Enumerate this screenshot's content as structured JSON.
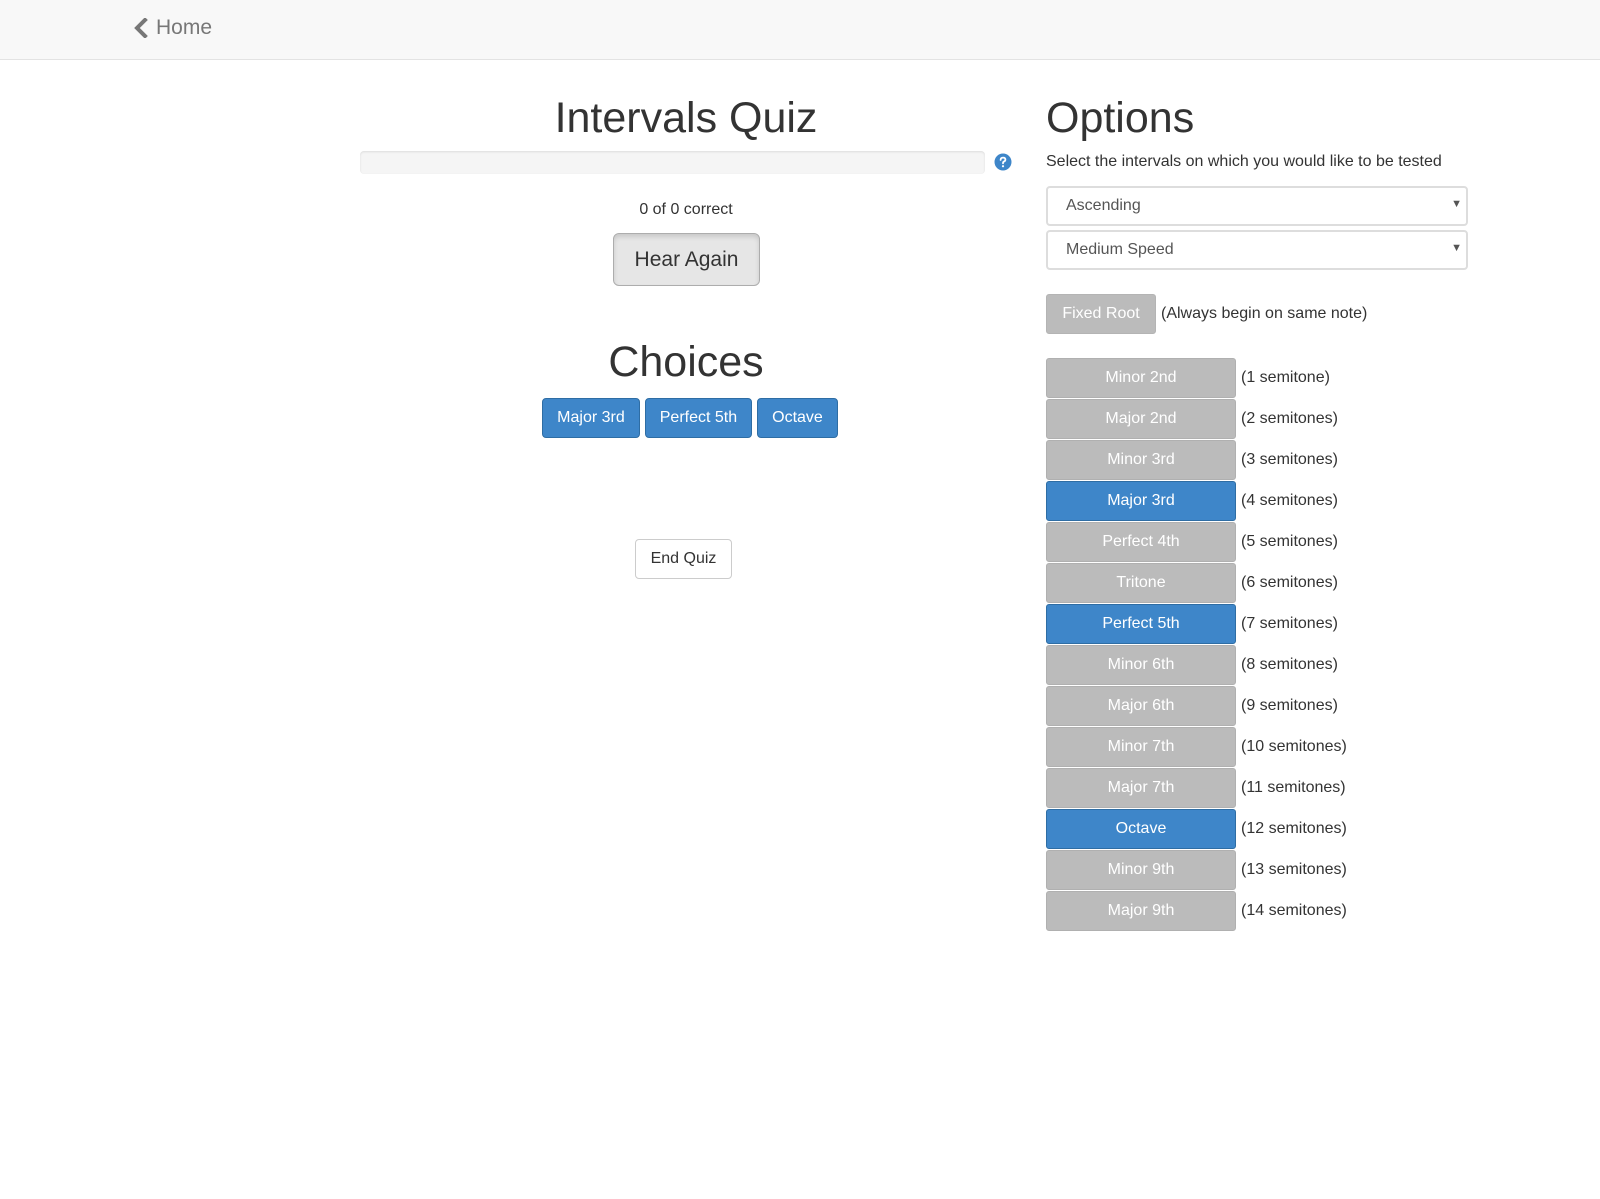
{
  "nav": {
    "home_label": "Home"
  },
  "quiz": {
    "title": "Intervals Quiz",
    "progress_fraction": 0,
    "score_text": "0 of 0 correct",
    "hear_again_label": "Hear Again",
    "choices_title": "Choices",
    "choices": [
      "Major 3rd",
      "Perfect 5th",
      "Octave"
    ],
    "end_quiz_label": "End Quiz"
  },
  "options": {
    "title": "Options",
    "description": "Select the intervals on which you would like to be tested",
    "direction_selected": "Ascending",
    "speed_selected": "Medium Speed",
    "fixed_root_label": "Fixed Root",
    "fixed_root_desc": "(Always begin on same note)",
    "intervals": [
      {
        "label": "Minor 2nd",
        "desc": "(1 semitone)",
        "selected": false
      },
      {
        "label": "Major 2nd",
        "desc": "(2 semitones)",
        "selected": false
      },
      {
        "label": "Minor 3rd",
        "desc": "(3 semitones)",
        "selected": false
      },
      {
        "label": "Major 3rd",
        "desc": "(4 semitones)",
        "selected": true
      },
      {
        "label": "Perfect 4th",
        "desc": "(5 semitones)",
        "selected": false
      },
      {
        "label": "Tritone",
        "desc": "(6 semitones)",
        "selected": false
      },
      {
        "label": "Perfect 5th",
        "desc": "(7 semitones)",
        "selected": true
      },
      {
        "label": "Minor 6th",
        "desc": "(8 semitones)",
        "selected": false
      },
      {
        "label": "Major 6th",
        "desc": "(9 semitones)",
        "selected": false
      },
      {
        "label": "Minor 7th",
        "desc": "(10 semitones)",
        "selected": false
      },
      {
        "label": "Major 7th",
        "desc": "(11 semitones)",
        "selected": false
      },
      {
        "label": "Octave",
        "desc": "(12 semitones)",
        "selected": true
      },
      {
        "label": "Minor 9th",
        "desc": "(13 semitones)",
        "selected": false
      },
      {
        "label": "Major 9th",
        "desc": "(14 semitones)",
        "selected": false
      }
    ]
  },
  "colors": {
    "accent": "#3e86c9",
    "inactive": "#bbbbbb"
  },
  "icons": {
    "back": "chevron-left-icon",
    "help": "question-circle-icon"
  }
}
